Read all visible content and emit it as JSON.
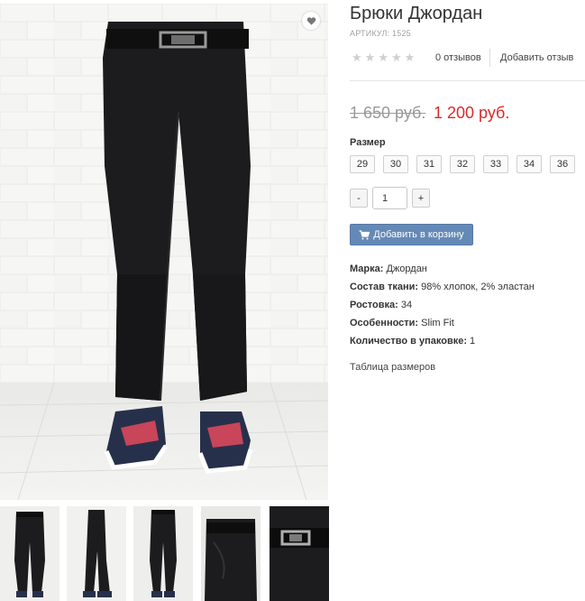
{
  "product": {
    "title": "Брюки Джордан",
    "sku": "АРТИКУЛ: 1525",
    "reviews_count": "0 отзывов",
    "add_review": "Добавить отзыв",
    "rating": 0,
    "rating_max": 5,
    "price_old": "1 650 руб.",
    "price_new": "1 200 руб."
  },
  "sizes": {
    "label": "Размер",
    "options": [
      "29",
      "30",
      "31",
      "32",
      "33",
      "34",
      "36"
    ]
  },
  "quantity": {
    "minus": "-",
    "value": "1",
    "plus": "+"
  },
  "cart": {
    "label": "Добавить в корзину",
    "icon": "cart-icon"
  },
  "properties": [
    {
      "label": "Марка:",
      "value": " Джордан"
    },
    {
      "label": "Состав ткани:",
      "value": " 98% хлопок, 2% эластан"
    },
    {
      "label": "Ростовка:",
      "value": " 34"
    },
    {
      "label": "Особенности:",
      "value": " Slim Fit"
    },
    {
      "label": "Количество в упаковке:",
      "value": " 1"
    }
  ],
  "size_table_link": "Таблица размеров",
  "icons": {
    "wishlist": "heart-icon",
    "star": "star-icon"
  },
  "colors": {
    "accent_button": "#6589b6",
    "sale_price": "#d82b2b",
    "old_price": "#999999"
  }
}
